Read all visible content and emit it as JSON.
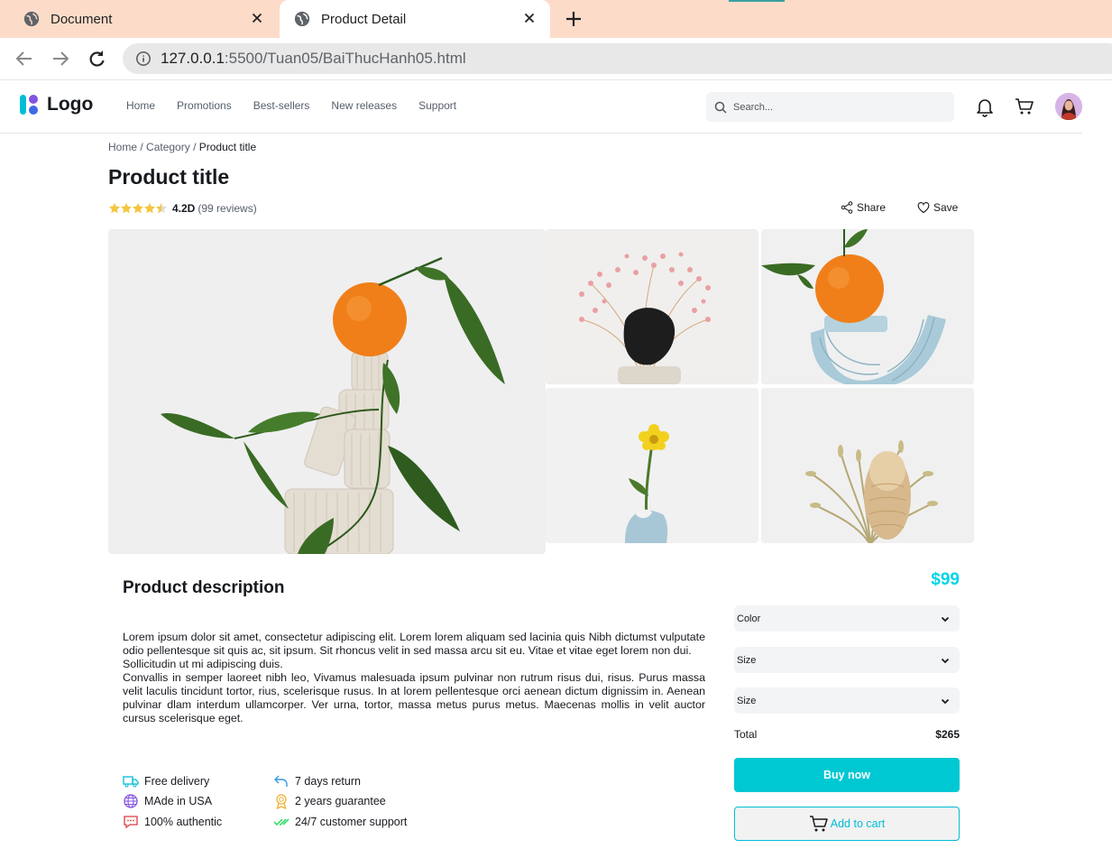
{
  "browser": {
    "tabs": [
      {
        "title": "Document",
        "active": false
      },
      {
        "title": "Product Detail",
        "active": true
      }
    ],
    "url_host": "127.0.0.1",
    "url_path": ":5500/Tuan05/BaiThucHanh05.html"
  },
  "header": {
    "logo_text": "Logo",
    "nav": [
      "Home",
      "Promotions",
      "Best-sellers",
      "New releases",
      "Support"
    ],
    "search_placeholder": "Search..."
  },
  "breadcrumb": {
    "home": "Home",
    "sep1": " / ",
    "category": "Category",
    "sep2": " / ",
    "current": "Product title"
  },
  "product": {
    "title": "Product title",
    "rating_value": 4.2,
    "rating_label": "4.2D",
    "reviews": "(99 reviews)",
    "share_label": "Share",
    "save_label": "Save",
    "price": "$99",
    "description_title": "Product description",
    "description": [
      "Lorem ipsum dolor sit amet, consectetur adipiscing elit. Lorem lorem aliquam sed lacinia quis Nibh dictumst vulputate odio pellentesque sit quis ac, sit ipsum. Sit rhoncus velit in sed massa arcu sit eu. Vitae et vitae eget lorem non dui.",
      "Sollicitudin ut mi adipiscing duis.",
      "Convallis in semper laoreet nibh leo, Vivamus malesuada ipsum pulvinar non rutrum risus dui, risus. Purus massa velit laculis tincidunt tortor, rius, scelerisque rusus. In at lorem pellentesque orci aenean dictum dignissim in. Aenean pulvinar dlam interdum ullamcorper. Ver urna, tortor, massa metus purus metus. Maecenas mollis in velit auctor cursus scelerisque eget."
    ],
    "features": {
      "free_delivery": "Free delivery",
      "made_in": "MAde in USA",
      "authentic": "100% authentic",
      "return": "7 days return",
      "guarantee": "2 years guarantee",
      "support": "24/7 customer support"
    },
    "options": {
      "color": "Color",
      "size1": "Size",
      "size2": "Size"
    },
    "total_label": "Total",
    "total_amount": "$265",
    "buy_label": "Buy now",
    "cart_label": "Add to cart"
  },
  "colors": {
    "accent": "#00c8d3",
    "price": "#00d5e6",
    "star": "#f3c63f",
    "tab_strip": "#fcdcc9"
  }
}
